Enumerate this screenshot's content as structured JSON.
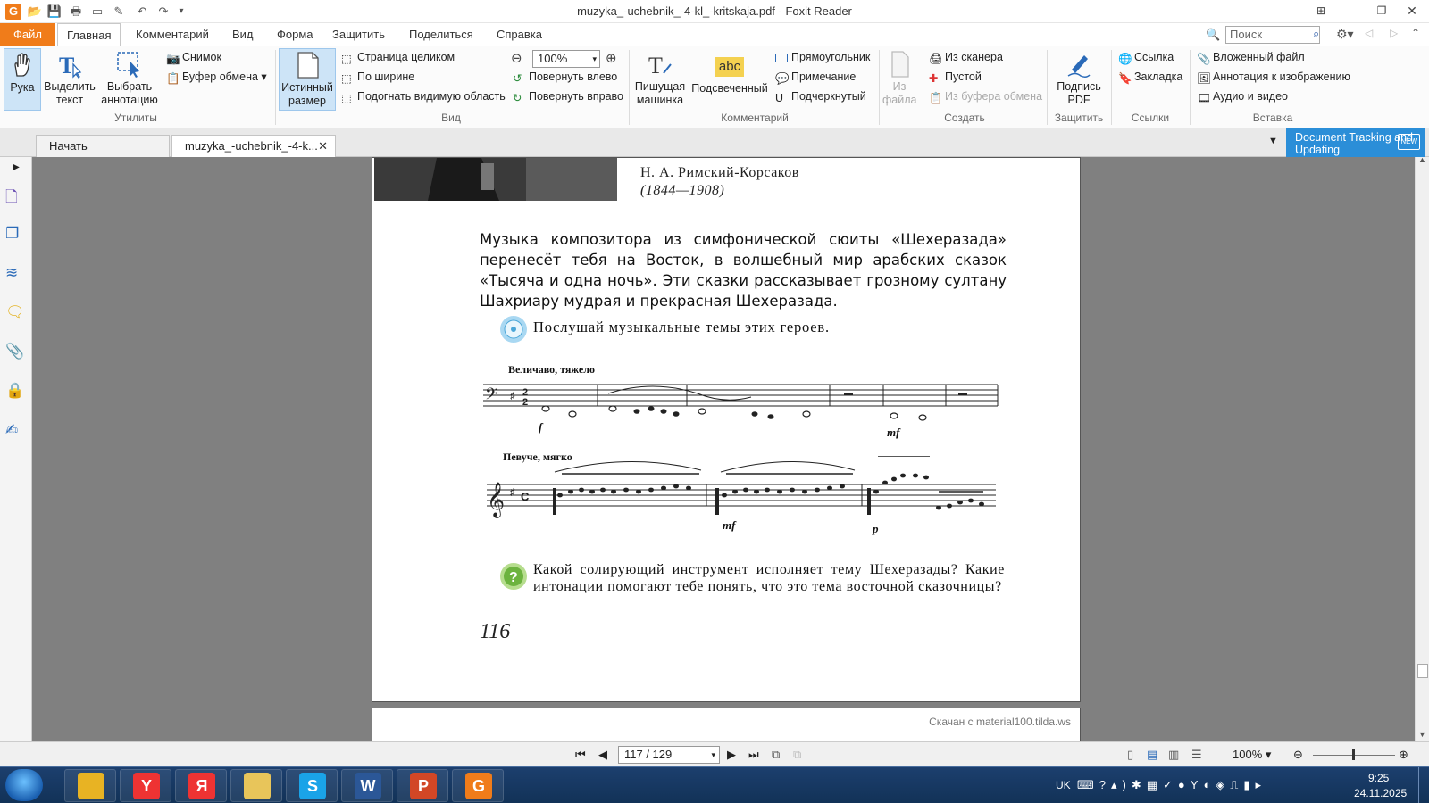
{
  "window": {
    "title": "muzyka_-uchebnik_-4-kl_-kritskaja.pdf - Foxit Reader",
    "app_icon": "G"
  },
  "menu": {
    "tabs": [
      "Файл",
      "Главная",
      "Комментарий",
      "Вид",
      "Форма",
      "Защитить",
      "Поделиться",
      "Справка"
    ],
    "active": "Главная",
    "search_placeholder": "Поиск"
  },
  "ribbon": {
    "utilities": {
      "hand": "Рука",
      "select_text": "Выделить текст",
      "select_annotation": "Выбрать аннотацию",
      "snapshot": "Снимок",
      "clipboard": "Буфер обмена",
      "label": "Утилиты"
    },
    "view": {
      "actual_size": "Истинный размер",
      "fit_page": "Страница целиком",
      "fit_width": "По ширине",
      "fit_visible": "Подогнать видимую область",
      "zoom_value": "100%",
      "rotate_left": "Повернуть влево",
      "rotate_right": "Повернуть вправо",
      "label": "Вид"
    },
    "comment": {
      "typewriter": "Пишущая машинка",
      "highlight": "Подсвеченный",
      "highlight_icon_text": "abc",
      "rectangle": "Прямоугольник",
      "note": "Примечание",
      "underline": "Подчеркнутый",
      "label": "Комментарий"
    },
    "create": {
      "from_file": "Из файла",
      "from_scanner": "Из сканера",
      "blank": "Пустой",
      "from_clipboard": "Из буфера обмена",
      "label": "Создать"
    },
    "protect": {
      "sign_pdf": "Подпись PDF",
      "label": "Защитить"
    },
    "links": {
      "link": "Ссылка",
      "bookmark": "Закладка",
      "label": "Ссылки"
    },
    "insert": {
      "attached_file": "Вложенный файл",
      "image_annotation": "Аннотация к изображению",
      "audio_video": "Аудио и видео",
      "label": "Вставка"
    }
  },
  "doc_tabs": {
    "start": "Начать",
    "current": "muzyka_-uchebnik_-4-k...",
    "banner": "Document Tracking and Updating",
    "banner_badge": "NEW"
  },
  "page": {
    "author": "Н. А. Римский-Корсаков",
    "years": "(1844—1908)",
    "paragraph": "Музыка композитора из симфонической сюиты «Шехеразада» перенесёт тебя на Восток, в волшебный мир арабских сказок «Тысяча и одна ночь». Эти сказки рассказывает грозному султану Шахриару мудрая и прекрасная Шехеразада.",
    "listen": "Послушай музыкальные темы этих героев.",
    "tempo1": "Величаво, тяжело",
    "tempo2": "Певуче, мягко",
    "question": "Какой солирующий инструмент исполняет тему Шехеразады? Какие интонации помогают тебе понять, что это тема восточной сказочницы?",
    "page_number": "116",
    "dynamics": [
      "f",
      "mf",
      "mf",
      "p"
    ]
  },
  "page2": {
    "watermark": "Скачан с material100.tilda.ws"
  },
  "status": {
    "page_indicator": "117 / 129",
    "zoom": "100%"
  },
  "taskbar": {
    "apps": [
      {
        "name": "chrome",
        "glyph": "",
        "color": "#e8b323"
      },
      {
        "name": "yandex-browser",
        "glyph": "Y",
        "color": "#e33"
      },
      {
        "name": "yandex",
        "glyph": "Я",
        "color": "#e33"
      },
      {
        "name": "explorer",
        "glyph": "",
        "color": "#e8c55a"
      },
      {
        "name": "skype",
        "glyph": "S",
        "color": "#1aa3e8"
      },
      {
        "name": "word",
        "glyph": "W",
        "color": "#2b5797"
      },
      {
        "name": "powerpoint",
        "glyph": "P",
        "color": "#d24726"
      },
      {
        "name": "foxit",
        "glyph": "G",
        "color": "#f07c1a"
      }
    ],
    "lang": "UK",
    "time": "9:25",
    "date": "24.11.2025"
  }
}
